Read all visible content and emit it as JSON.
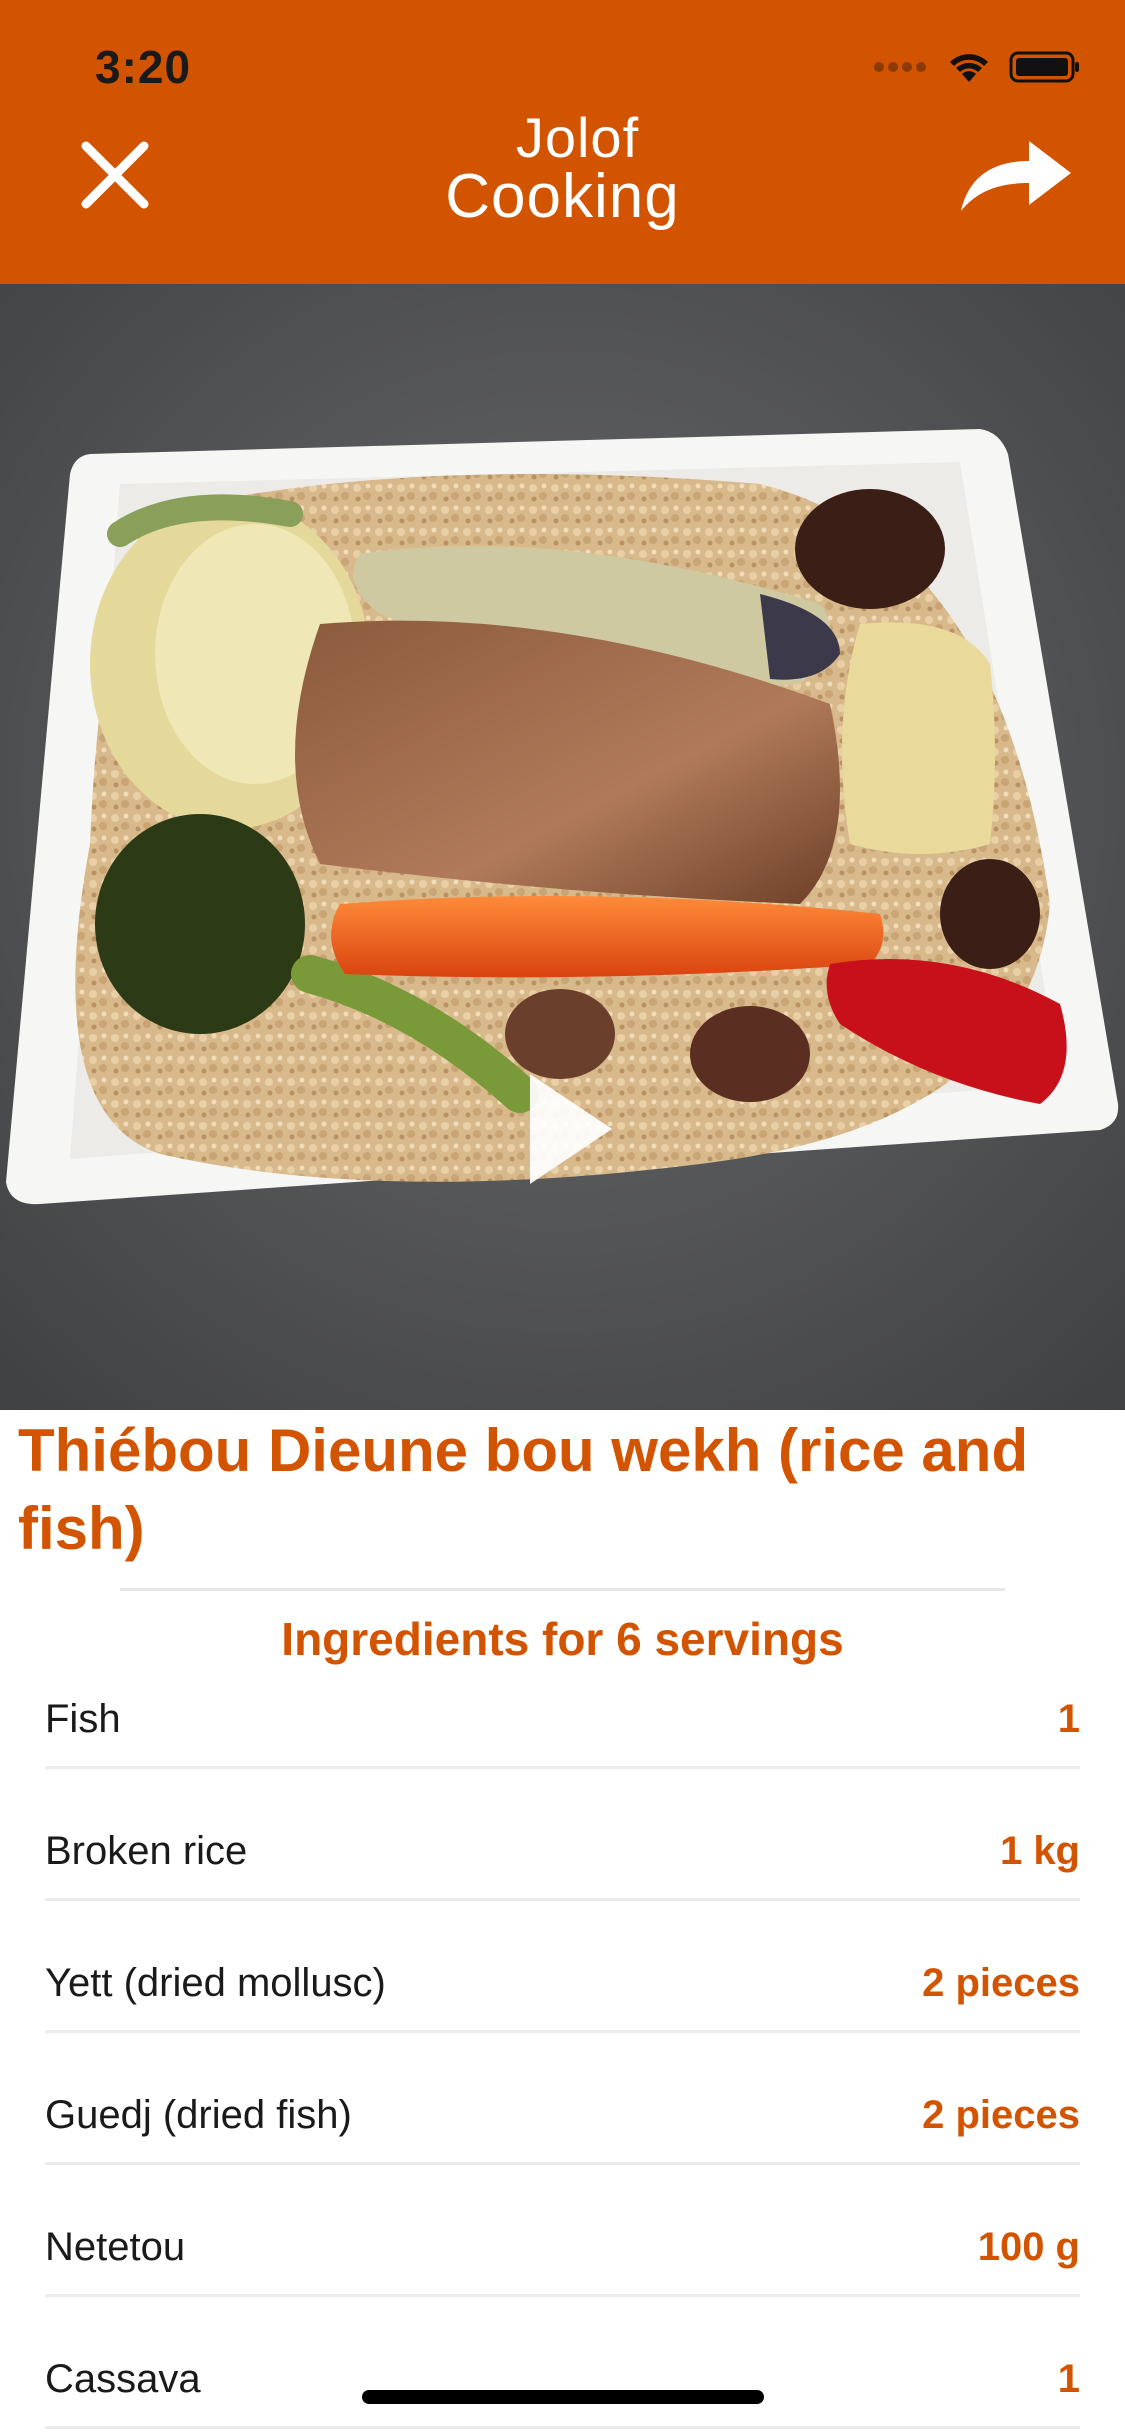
{
  "status_bar": {
    "time": "3:20",
    "icons": [
      "signal-dots-icon",
      "wifi-icon",
      "battery-icon"
    ]
  },
  "header": {
    "logo_line1": "Jolof",
    "logo_line2": "Cooking",
    "close_icon": "close-icon",
    "share_icon": "share-arrow-icon",
    "background_color": "#d35400"
  },
  "photo": {
    "play_icon": "play-icon"
  },
  "recipe": {
    "title": "Thiébou Dieune bou wekh (rice and fish)",
    "ingredients_heading": "Ingredients for 6 servings",
    "ingredients": [
      {
        "name": "Fish",
        "quantity": "1"
      },
      {
        "name": "Broken rice",
        "quantity": "1 kg"
      },
      {
        "name": "Yett (dried mollusc)",
        "quantity": "2 pieces"
      },
      {
        "name": "Guedj (dried fish)",
        "quantity": "2 pieces"
      },
      {
        "name": "Netetou",
        "quantity": "100 g"
      },
      {
        "name": "Cassava",
        "quantity": "1"
      }
    ]
  },
  "colors": {
    "accent": "#d35400",
    "text": "#1a1a1a"
  }
}
